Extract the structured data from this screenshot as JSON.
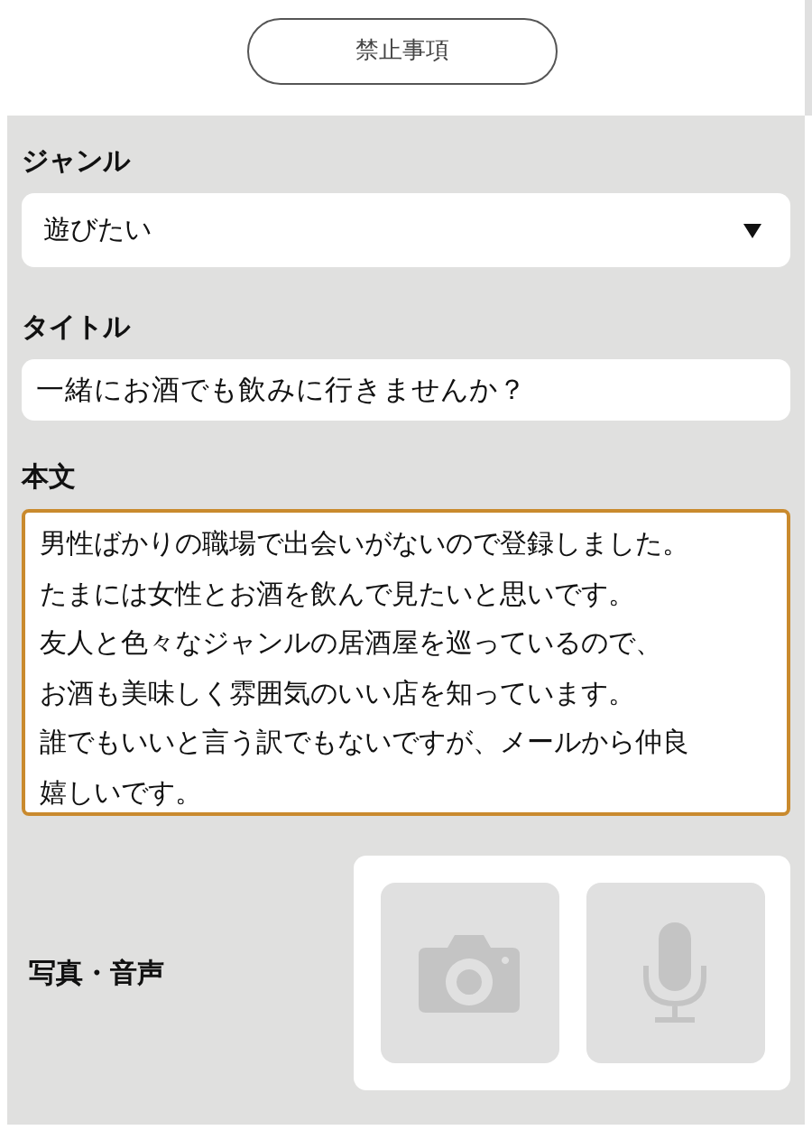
{
  "rules_button": {
    "label": "禁止事項"
  },
  "genre": {
    "label": "ジャンル",
    "value": "遊びたい"
  },
  "title": {
    "label": "タイトル",
    "value": "一緒にお酒でも飲みに行きませんか？"
  },
  "body": {
    "label": "本文",
    "focused": true,
    "lines": [
      "男性ばかりの職場で出会いがないので登録しました。",
      "たまには女性とお酒を飲んで見たいと思いです。",
      "友人と色々なジャンルの居酒屋を巡っているので、",
      "お酒も美味しく雰囲気のいい店を知っています。",
      "誰でもいいと言う訳でもないですが、メールから仲良",
      "嬉しいです。"
    ]
  },
  "media": {
    "label": "写真・音声",
    "buttons": [
      {
        "kind": "camera"
      },
      {
        "kind": "microphone"
      }
    ]
  }
}
